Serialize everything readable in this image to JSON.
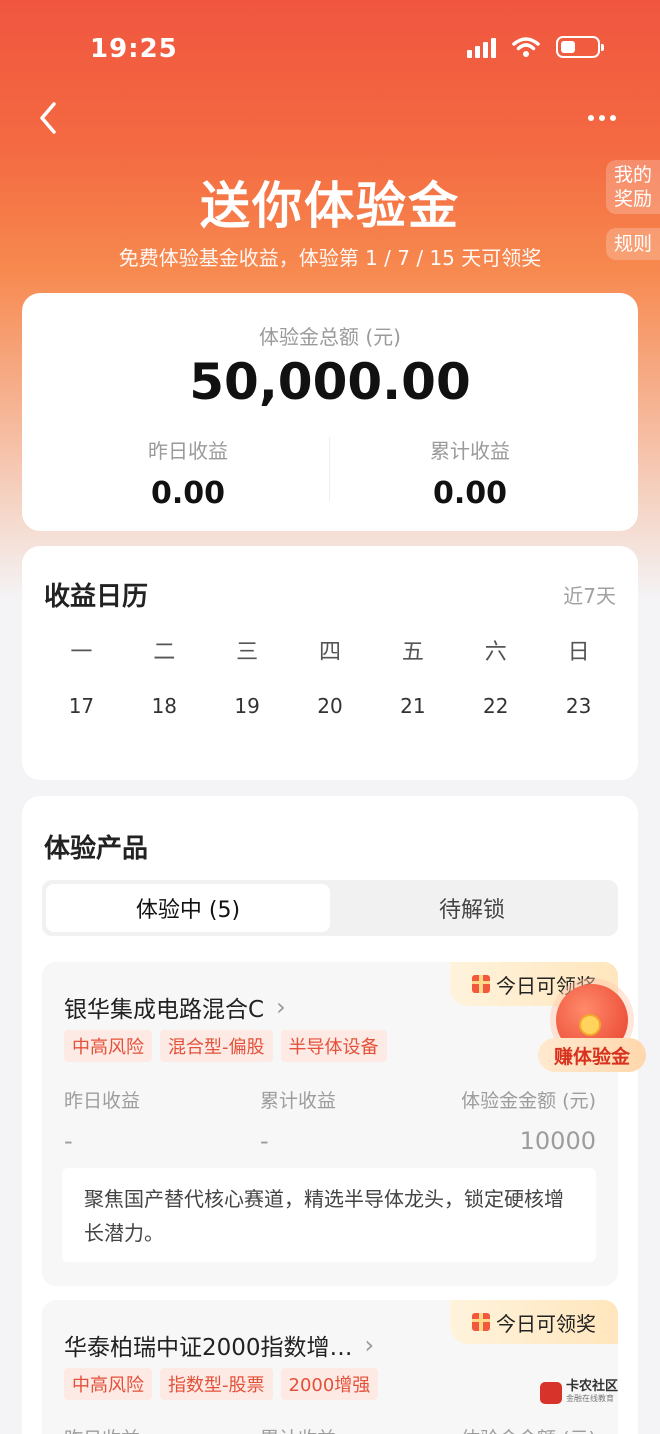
{
  "status_bar": {
    "time": "19:25"
  },
  "header": {
    "title": "送你体验金",
    "subtitle": "免费体验基金收益，体验第 1 / 7 / 15 天可领奖",
    "side_rewards": "我的奖励",
    "side_rules": "规则"
  },
  "summary": {
    "total_label": "体验金总额 (元)",
    "total_value": "50,000.00",
    "yesterday_label": "昨日收益",
    "yesterday_value": "0.00",
    "cumulative_label": "累计收益",
    "cumulative_value": "0.00"
  },
  "calendar": {
    "title": "收益日历",
    "range": "近7天",
    "weekdays": [
      "一",
      "二",
      "三",
      "四",
      "五",
      "六",
      "日"
    ],
    "dates": [
      "17",
      "18",
      "19",
      "20",
      "21",
      "22",
      "23"
    ]
  },
  "products": {
    "title": "体验产品",
    "tabs": [
      {
        "label": "体验中 (5)",
        "active": true
      },
      {
        "label": "待解锁",
        "active": false
      }
    ],
    "items": [
      {
        "badge": "今日可领奖",
        "name": "银华集成电路混合C",
        "tags": [
          "中高风险",
          "混合型-偏股",
          "半导体设备"
        ],
        "metric_labels": [
          "昨日收益",
          "累计收益",
          "体验金金额 (元)"
        ],
        "metric_values": [
          "-",
          "-",
          "10000"
        ],
        "description": "聚焦国产替代核心赛道，精选半导体龙头，锁定硬核增长潜力。"
      },
      {
        "badge": "今日可领奖",
        "name": "华泰柏瑞中证2000指数增…",
        "tags": [
          "中高风险",
          "指数型-股票",
          "2000增强"
        ],
        "metric_labels": [
          "昨日收益",
          "累计收益",
          "体验金金额 (元)"
        ]
      }
    ]
  },
  "float_widget": {
    "label": "赚体验金"
  },
  "watermark": {
    "main": "卡农社区",
    "sub": "金融在线教育"
  },
  "colors": {
    "accent": "#f0563f",
    "tag_text": "#e4513a",
    "tag_bg": "#fdeae4"
  }
}
